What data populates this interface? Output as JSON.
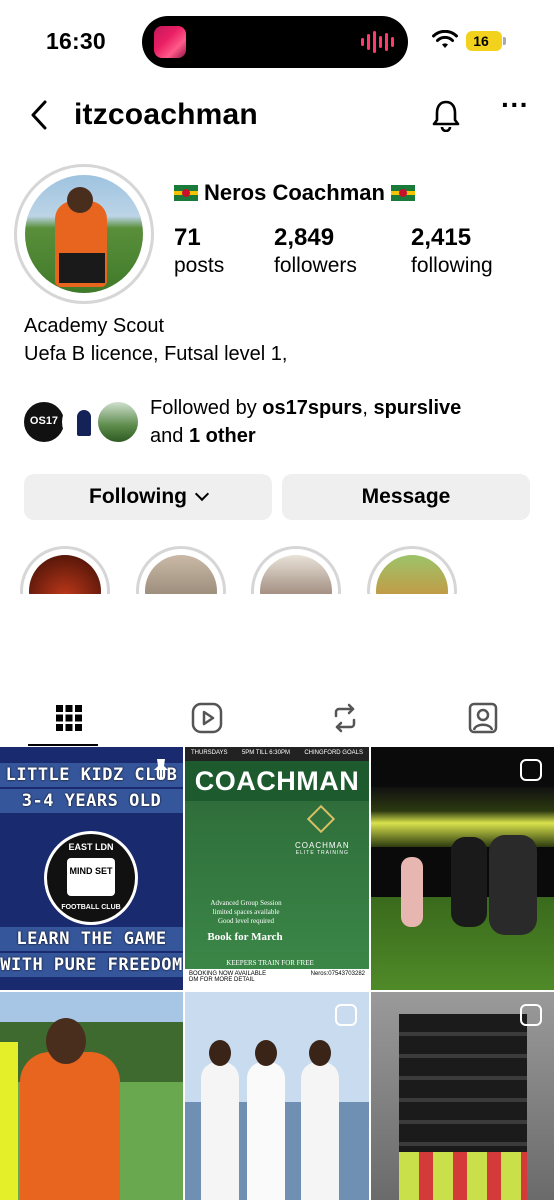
{
  "status_bar": {
    "time": "16:30",
    "battery": "16"
  },
  "header": {
    "username": "itzcoachman"
  },
  "profile": {
    "display_name": "Neros Coachman",
    "stats": [
      {
        "value": "71",
        "label": "posts"
      },
      {
        "value": "2,849",
        "label": "followers"
      },
      {
        "value": "2,415",
        "label": "following"
      }
    ],
    "bio": [
      "Academy Scout",
      "Uefa B licence, Futsal level 1,"
    ],
    "followed_by": {
      "prefix": "Followed by ",
      "user1": "os17spurs",
      "separator": ", ",
      "user2": "spurslive",
      "line2_prefix": "and ",
      "others": "1 other"
    },
    "buttons": {
      "following": "Following",
      "message": "Message"
    }
  },
  "tabs": [
    {
      "name": "grid-icon",
      "active": true
    },
    {
      "name": "reels-icon",
      "active": false
    },
    {
      "name": "reposts-icon",
      "active": false
    },
    {
      "name": "tagged-icon",
      "active": false
    }
  ],
  "posts": {
    "p1": {
      "banner_top1": "LITTLE KIDZ CLUB",
      "banner_top2": "3-4 YEARS OLD",
      "logo_top": "EAST LDN",
      "logo_center": "MIND SET",
      "logo_bottom": "FOOTBALL CLUB",
      "banner_bot1": "LEARN THE GAME",
      "banner_bot2": "WITH PURE FREEDOM"
    },
    "p2": {
      "day": "THURSDAYS",
      "time": "5PM TILL 6:30PM",
      "place": "CHINGFORD GOALS",
      "title": "COACHMAN",
      "brand": "COACHMAN",
      "sub": "ELITE TRAINING",
      "session": "Advanced Group Session",
      "spaces": "limited spaces available",
      "level": "Good level required",
      "book": "Book for March",
      "keepers": "KEEPERS TRAIN FOR FREE",
      "booking": "BOOKING NOW AVAILABLE",
      "dm": "DM FOR MORE DETAIL",
      "contact": "Neros:07543703282"
    }
  },
  "colors": {
    "accent_button": "#efefef",
    "ring": "#d6d6d6",
    "battery": "#f2d21c"
  }
}
